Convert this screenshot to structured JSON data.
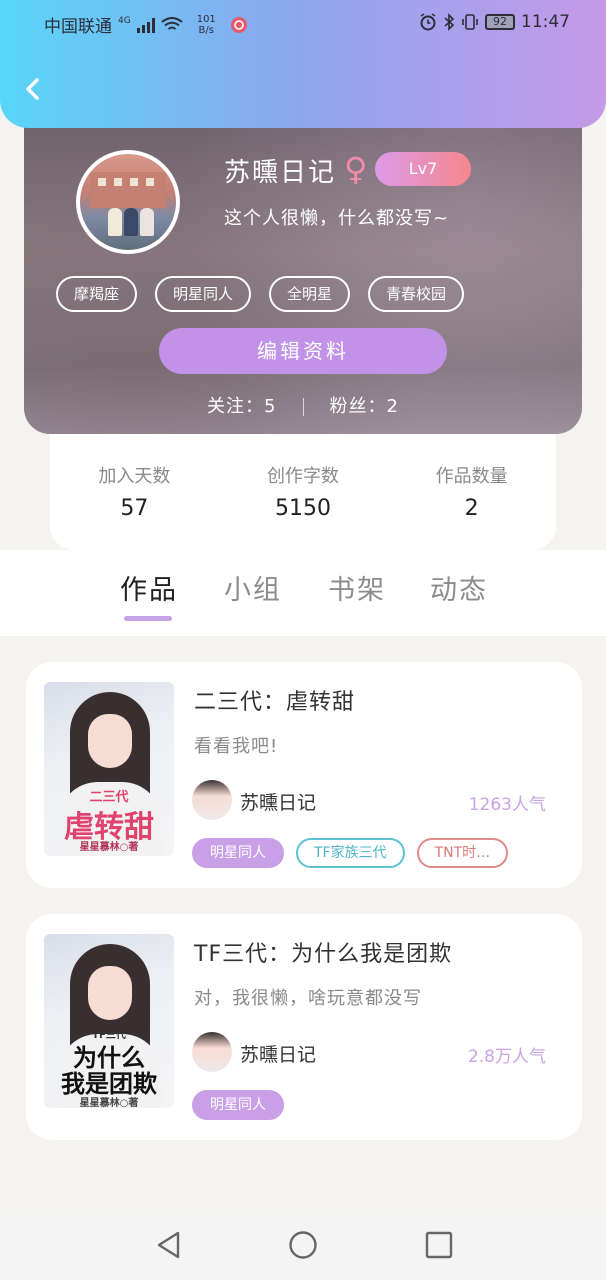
{
  "status_bar": {
    "carrier": "中国联通",
    "network": "4G",
    "speed_value": "101",
    "speed_unit": "B/s",
    "battery": "92",
    "time": "11:47"
  },
  "profile": {
    "name": "苏曛日记",
    "gender_symbol": "♀",
    "level": "Lv7",
    "bio": "这个人很懒，什么都没写~",
    "tags": [
      "摩羯座",
      "明星同人",
      "全明星",
      "青春校园"
    ],
    "edit_label": "编辑资料",
    "follow_label": "关注：5",
    "fans_label": "粉丝：2"
  },
  "stats": [
    {
      "label": "加入天数",
      "value": "57"
    },
    {
      "label": "创作字数",
      "value": "5150"
    },
    {
      "label": "作品数量",
      "value": "2"
    }
  ],
  "tabs": [
    "作品",
    "小组",
    "书架",
    "动态"
  ],
  "works": [
    {
      "title": "二三代：虐转甜",
      "desc": "看看我吧!",
      "author": "苏曛日记",
      "popularity": "1263人气",
      "tags": [
        "明星同人",
        "TF家族三代",
        "TNT时…"
      ],
      "cover_text_small": "二三代",
      "cover_text_main": "虐转甜",
      "cover_credit": "星星慕林○著"
    },
    {
      "title": "TF三代：为什么我是团欺",
      "desc": "对，我很懒，啥玩意都没写",
      "author": "苏曛日记",
      "popularity": "2.8万人气",
      "tags": [
        "明星同人"
      ],
      "cover_text_small": "TF三代",
      "cover_text_main_1": "为什么",
      "cover_text_main_2": "我是团欺",
      "cover_credit": "星星慕林○著"
    }
  ],
  "colors": {
    "header_start": "#58d6f7",
    "header_end": "#c59ae8",
    "accent_purple": "#c192e8",
    "level_badge": "#f5878e"
  }
}
